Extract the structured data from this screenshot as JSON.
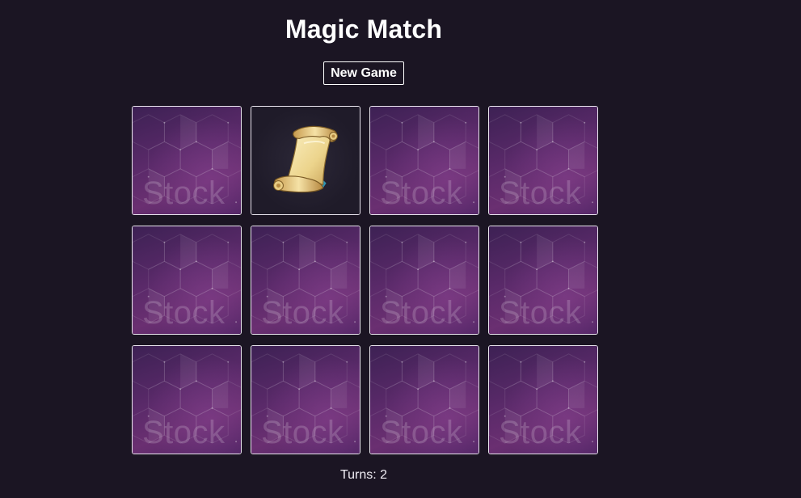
{
  "game": {
    "title": "Magic Match",
    "new_game_label": "New Game",
    "turns_label": "Turns:",
    "turns_value": "2",
    "turns_text": "Turns: 2"
  },
  "cards": [
    {
      "state": "face-down",
      "watermark": "Stock"
    },
    {
      "state": "face-up",
      "icon": "scroll-icon"
    },
    {
      "state": "face-down",
      "watermark": "Stock"
    },
    {
      "state": "face-down",
      "watermark": "Stock"
    },
    {
      "state": "face-down",
      "watermark": "Stock"
    },
    {
      "state": "face-down",
      "watermark": "Stock"
    },
    {
      "state": "face-down",
      "watermark": "Stock"
    },
    {
      "state": "face-down",
      "watermark": "Stock"
    },
    {
      "state": "face-down",
      "watermark": "Stock"
    },
    {
      "state": "face-down",
      "watermark": "Stock"
    },
    {
      "state": "face-down",
      "watermark": "Stock"
    },
    {
      "state": "face-down",
      "watermark": "Stock"
    }
  ],
  "colors": {
    "background": "#1b1523",
    "card_back": "#5b2a6a",
    "card_border": "#e9e4ee",
    "text": "#ffffff"
  }
}
